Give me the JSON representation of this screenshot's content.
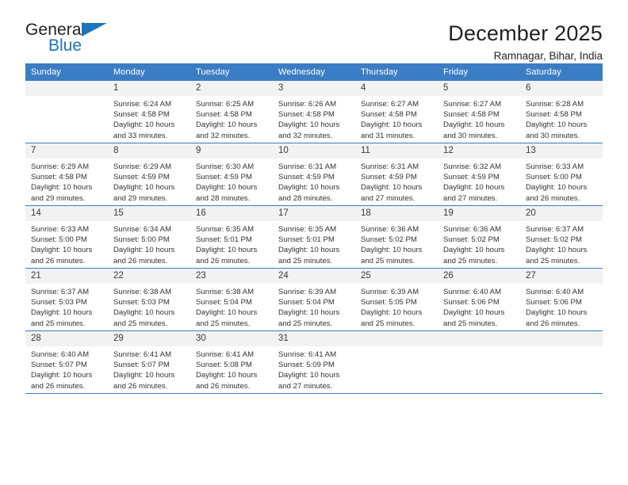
{
  "brand": {
    "name_top": "General",
    "name_bottom": "Blue",
    "accent_color": "#1b75bb",
    "triangle_icon": "brand-triangle-icon"
  },
  "header": {
    "title": "December 2025",
    "subtitle": "Ramnagar, Bihar, India"
  },
  "theme": {
    "header_row_bg": "#3b7dc4",
    "daynum_bg": "#f2f2f2",
    "text_color": "#333333"
  },
  "weekday_headers": [
    "Sunday",
    "Monday",
    "Tuesday",
    "Wednesday",
    "Thursday",
    "Friday",
    "Saturday"
  ],
  "weeks": [
    [
      {
        "day": "",
        "blank": true,
        "sunrise": "",
        "sunset": "",
        "daylight_line1": "",
        "daylight_line2": ""
      },
      {
        "day": "1",
        "sunrise": "Sunrise: 6:24 AM",
        "sunset": "Sunset: 4:58 PM",
        "daylight_line1": "Daylight: 10 hours",
        "daylight_line2": "and 33 minutes."
      },
      {
        "day": "2",
        "sunrise": "Sunrise: 6:25 AM",
        "sunset": "Sunset: 4:58 PM",
        "daylight_line1": "Daylight: 10 hours",
        "daylight_line2": "and 32 minutes."
      },
      {
        "day": "3",
        "sunrise": "Sunrise: 6:26 AM",
        "sunset": "Sunset: 4:58 PM",
        "daylight_line1": "Daylight: 10 hours",
        "daylight_line2": "and 32 minutes."
      },
      {
        "day": "4",
        "sunrise": "Sunrise: 6:27 AM",
        "sunset": "Sunset: 4:58 PM",
        "daylight_line1": "Daylight: 10 hours",
        "daylight_line2": "and 31 minutes."
      },
      {
        "day": "5",
        "sunrise": "Sunrise: 6:27 AM",
        "sunset": "Sunset: 4:58 PM",
        "daylight_line1": "Daylight: 10 hours",
        "daylight_line2": "and 30 minutes."
      },
      {
        "day": "6",
        "sunrise": "Sunrise: 6:28 AM",
        "sunset": "Sunset: 4:58 PM",
        "daylight_line1": "Daylight: 10 hours",
        "daylight_line2": "and 30 minutes."
      }
    ],
    [
      {
        "day": "7",
        "sunrise": "Sunrise: 6:29 AM",
        "sunset": "Sunset: 4:58 PM",
        "daylight_line1": "Daylight: 10 hours",
        "daylight_line2": "and 29 minutes."
      },
      {
        "day": "8",
        "sunrise": "Sunrise: 6:29 AM",
        "sunset": "Sunset: 4:59 PM",
        "daylight_line1": "Daylight: 10 hours",
        "daylight_line2": "and 29 minutes."
      },
      {
        "day": "9",
        "sunrise": "Sunrise: 6:30 AM",
        "sunset": "Sunset: 4:59 PM",
        "daylight_line1": "Daylight: 10 hours",
        "daylight_line2": "and 28 minutes."
      },
      {
        "day": "10",
        "sunrise": "Sunrise: 6:31 AM",
        "sunset": "Sunset: 4:59 PM",
        "daylight_line1": "Daylight: 10 hours",
        "daylight_line2": "and 28 minutes."
      },
      {
        "day": "11",
        "sunrise": "Sunrise: 6:31 AM",
        "sunset": "Sunset: 4:59 PM",
        "daylight_line1": "Daylight: 10 hours",
        "daylight_line2": "and 27 minutes."
      },
      {
        "day": "12",
        "sunrise": "Sunrise: 6:32 AM",
        "sunset": "Sunset: 4:59 PM",
        "daylight_line1": "Daylight: 10 hours",
        "daylight_line2": "and 27 minutes."
      },
      {
        "day": "13",
        "sunrise": "Sunrise: 6:33 AM",
        "sunset": "Sunset: 5:00 PM",
        "daylight_line1": "Daylight: 10 hours",
        "daylight_line2": "and 26 minutes."
      }
    ],
    [
      {
        "day": "14",
        "sunrise": "Sunrise: 6:33 AM",
        "sunset": "Sunset: 5:00 PM",
        "daylight_line1": "Daylight: 10 hours",
        "daylight_line2": "and 26 minutes."
      },
      {
        "day": "15",
        "sunrise": "Sunrise: 6:34 AM",
        "sunset": "Sunset: 5:00 PM",
        "daylight_line1": "Daylight: 10 hours",
        "daylight_line2": "and 26 minutes."
      },
      {
        "day": "16",
        "sunrise": "Sunrise: 6:35 AM",
        "sunset": "Sunset: 5:01 PM",
        "daylight_line1": "Daylight: 10 hours",
        "daylight_line2": "and 26 minutes."
      },
      {
        "day": "17",
        "sunrise": "Sunrise: 6:35 AM",
        "sunset": "Sunset: 5:01 PM",
        "daylight_line1": "Daylight: 10 hours",
        "daylight_line2": "and 25 minutes."
      },
      {
        "day": "18",
        "sunrise": "Sunrise: 6:36 AM",
        "sunset": "Sunset: 5:02 PM",
        "daylight_line1": "Daylight: 10 hours",
        "daylight_line2": "and 25 minutes."
      },
      {
        "day": "19",
        "sunrise": "Sunrise: 6:36 AM",
        "sunset": "Sunset: 5:02 PM",
        "daylight_line1": "Daylight: 10 hours",
        "daylight_line2": "and 25 minutes."
      },
      {
        "day": "20",
        "sunrise": "Sunrise: 6:37 AM",
        "sunset": "Sunset: 5:02 PM",
        "daylight_line1": "Daylight: 10 hours",
        "daylight_line2": "and 25 minutes."
      }
    ],
    [
      {
        "day": "21",
        "sunrise": "Sunrise: 6:37 AM",
        "sunset": "Sunset: 5:03 PM",
        "daylight_line1": "Daylight: 10 hours",
        "daylight_line2": "and 25 minutes."
      },
      {
        "day": "22",
        "sunrise": "Sunrise: 6:38 AM",
        "sunset": "Sunset: 5:03 PM",
        "daylight_line1": "Daylight: 10 hours",
        "daylight_line2": "and 25 minutes."
      },
      {
        "day": "23",
        "sunrise": "Sunrise: 6:38 AM",
        "sunset": "Sunset: 5:04 PM",
        "daylight_line1": "Daylight: 10 hours",
        "daylight_line2": "and 25 minutes."
      },
      {
        "day": "24",
        "sunrise": "Sunrise: 6:39 AM",
        "sunset": "Sunset: 5:04 PM",
        "daylight_line1": "Daylight: 10 hours",
        "daylight_line2": "and 25 minutes."
      },
      {
        "day": "25",
        "sunrise": "Sunrise: 6:39 AM",
        "sunset": "Sunset: 5:05 PM",
        "daylight_line1": "Daylight: 10 hours",
        "daylight_line2": "and 25 minutes."
      },
      {
        "day": "26",
        "sunrise": "Sunrise: 6:40 AM",
        "sunset": "Sunset: 5:06 PM",
        "daylight_line1": "Daylight: 10 hours",
        "daylight_line2": "and 25 minutes."
      },
      {
        "day": "27",
        "sunrise": "Sunrise: 6:40 AM",
        "sunset": "Sunset: 5:06 PM",
        "daylight_line1": "Daylight: 10 hours",
        "daylight_line2": "and 26 minutes."
      }
    ],
    [
      {
        "day": "28",
        "sunrise": "Sunrise: 6:40 AM",
        "sunset": "Sunset: 5:07 PM",
        "daylight_line1": "Daylight: 10 hours",
        "daylight_line2": "and 26 minutes."
      },
      {
        "day": "29",
        "sunrise": "Sunrise: 6:41 AM",
        "sunset": "Sunset: 5:07 PM",
        "daylight_line1": "Daylight: 10 hours",
        "daylight_line2": "and 26 minutes."
      },
      {
        "day": "30",
        "sunrise": "Sunrise: 6:41 AM",
        "sunset": "Sunset: 5:08 PM",
        "daylight_line1": "Daylight: 10 hours",
        "daylight_line2": "and 26 minutes."
      },
      {
        "day": "31",
        "sunrise": "Sunrise: 6:41 AM",
        "sunset": "Sunset: 5:09 PM",
        "daylight_line1": "Daylight: 10 hours",
        "daylight_line2": "and 27 minutes."
      },
      {
        "day": "",
        "blank": true,
        "sunrise": "",
        "sunset": "",
        "daylight_line1": "",
        "daylight_line2": ""
      },
      {
        "day": "",
        "blank": true,
        "sunrise": "",
        "sunset": "",
        "daylight_line1": "",
        "daylight_line2": ""
      },
      {
        "day": "",
        "blank": true,
        "sunrise": "",
        "sunset": "",
        "daylight_line1": "",
        "daylight_line2": ""
      }
    ]
  ]
}
